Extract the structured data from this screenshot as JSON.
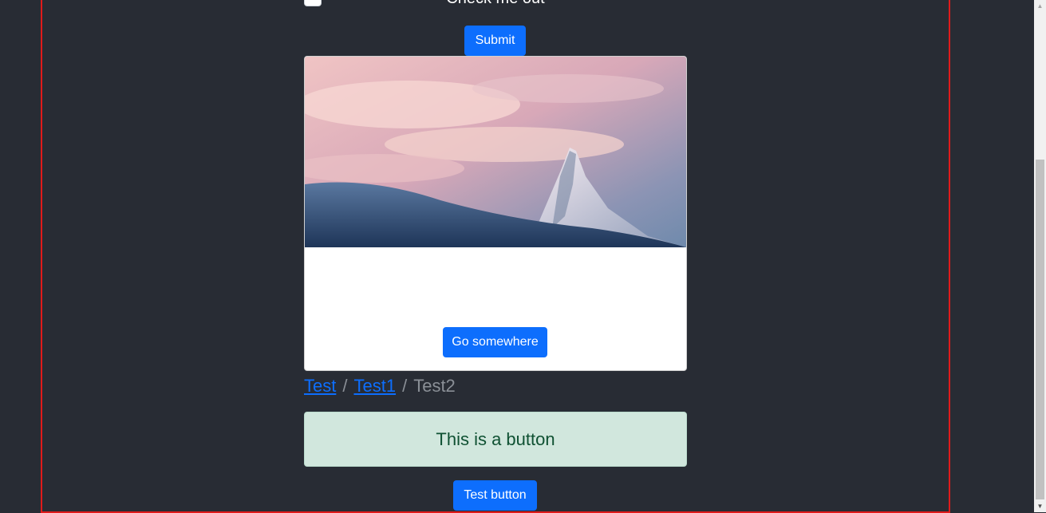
{
  "form": {
    "checkbox_label": "Check me out",
    "submit_label": "Submit"
  },
  "card": {
    "image_alt": "Snowy mountain peak at sunset",
    "button_label": "Go somewhere"
  },
  "breadcrumb": {
    "items": [
      {
        "label": "Test",
        "link": true
      },
      {
        "label": "Test1",
        "link": true
      },
      {
        "label": "Test2",
        "link": false
      }
    ],
    "separator": "/"
  },
  "alert": {
    "text": "This is a button"
  },
  "test_button": {
    "label": "Test button"
  },
  "scrollbar": {
    "up_arrow": "▲",
    "down_arrow": "▼"
  },
  "colors": {
    "background": "#282c34",
    "frame_border": "#e01b1b",
    "primary": "#0d6efd",
    "alert_bg": "#d1e7dd",
    "alert_text": "#0f5132"
  }
}
